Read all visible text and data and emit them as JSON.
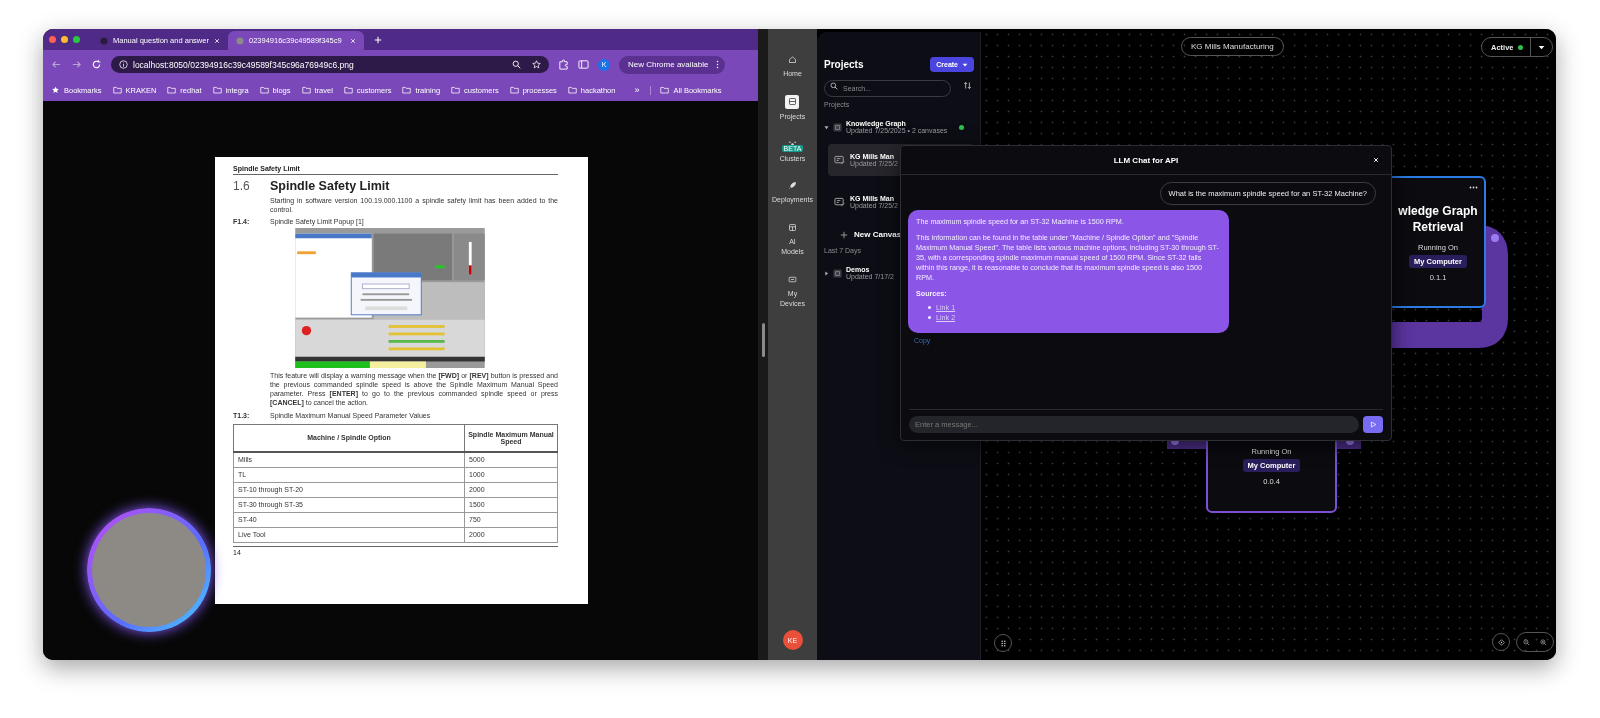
{
  "browser": {
    "tabs": [
      {
        "title": "Manual question and answer",
        "selected": false
      },
      {
        "title": "02394916c39c49589f345c9",
        "selected": true
      }
    ],
    "url": "localhost:8050/02394916c39c49589f345c96a76949c6.png",
    "profile_initial": "K",
    "update_button": "New Chrome available",
    "bookmarks": [
      {
        "label": "Bookmarks",
        "kind": "star"
      },
      {
        "label": "KRAKEN",
        "kind": "folder"
      },
      {
        "label": "redhat",
        "kind": "folder"
      },
      {
        "label": "integra",
        "kind": "folder"
      },
      {
        "label": "blogs",
        "kind": "folder"
      },
      {
        "label": "travel",
        "kind": "folder"
      },
      {
        "label": "customers",
        "kind": "folder"
      },
      {
        "label": "training",
        "kind": "folder"
      },
      {
        "label": "customers",
        "kind": "folder"
      },
      {
        "label": "processes",
        "kind": "folder"
      },
      {
        "label": "hackathon",
        "kind": "folder"
      }
    ],
    "more": "»",
    "all_bookmarks": "All Bookmarks"
  },
  "document": {
    "running_header": "Spindle Safety Limit",
    "section_number": "1.6",
    "section_title": "Spindle Safety Limit",
    "intro": "Starting in software version 100.19.000.1100 a spindle safety limit has been added to the control.",
    "figure_label": "F1.4:",
    "figure_caption": "Spindle Safety Limit Popup [1]",
    "paragraph": "This feature will display a warning message when the **[FWD]** or **[REV]** button is pressed and the previous commanded spindle speed is above the Spindle Maximum Manual Speed parameter. Press **[ENTER]** to go to the previous commanded spindle speed or press **[CANCEL]** to cancel the action.",
    "table_label": "T1.3:",
    "table_caption": "Spindle Maximum Manual Speed Parameter Values",
    "table": {
      "columns": [
        "Machine / Spindle Option",
        "Spindle Maximum Manual Speed"
      ],
      "rows": [
        [
          "Mills",
          "5000"
        ],
        [
          "TL",
          "1000"
        ],
        [
          "ST-10 through ST-20",
          "2000"
        ],
        [
          "ST-30 through ST-35",
          "1500"
        ],
        [
          "ST-40",
          "750"
        ],
        [
          "Live Tool",
          "2000"
        ]
      ]
    },
    "page_number": "14"
  },
  "app": {
    "sidebar": {
      "items": [
        {
          "label": "Home",
          "kind": "home",
          "selected": false
        },
        {
          "label": "Projects",
          "kind": "projects",
          "selected": true
        },
        {
          "label": "Clusters",
          "kind": "clusters",
          "selected": false,
          "badge": "BETA"
        },
        {
          "label": "Deployments",
          "kind": "deployments",
          "selected": false
        },
        {
          "label": "AI Models",
          "kind": "models",
          "selected": false
        },
        {
          "label": "My Devices",
          "kind": "devices",
          "selected": false
        }
      ],
      "user_initials": "KE"
    },
    "projects": {
      "title": "Projects",
      "create_button": "Create",
      "search_placeholder": "Search...",
      "section_label": "Projects",
      "items": [
        {
          "name": "Knowledge Graph",
          "meta": "Updated 7/25/2025 • 2 canvases",
          "expanded": true,
          "active": true,
          "children": [
            {
              "name": "KG Mills Man",
              "meta": "Updated 7/25/2",
              "selected": true
            },
            {
              "name": "KG Mills Man",
              "meta": "Updated 7/25/2",
              "selected": false
            }
          ]
        }
      ],
      "new_canvas": "New Canvas",
      "recent_label": "Last 7 Days",
      "recent_items": [
        {
          "name": "Demos",
          "meta": "Updated 7/17/2",
          "expanded": false
        }
      ]
    },
    "canvas": {
      "title": "KG Mills Manufacturing",
      "status": "Active",
      "nodes": [
        {
          "title": "wledge Graph Retrieval",
          "running_label": "Running On",
          "host": "My Computer",
          "version": "0.1.1",
          "selected": true
        },
        {
          "running_label": "Running On",
          "host": "My Computer",
          "version": "0.0.4",
          "selected": false
        }
      ]
    },
    "chat": {
      "title": "LLM Chat for API",
      "messages": [
        {
          "kind": "user",
          "text": "What is the maximum spindle speed for an ST-32 Machine?"
        },
        {
          "kind": "assistant",
          "paragraphs": [
            "The maximum spindle speed for an ST-32 Machine is 1500 RPM.",
            "This information can be found in the table under \"Machine / Spindle Option\" and \"Spindle Maximum Manual Speed\". The table lists various machine options, including ST-30 through ST-35, with a corresponding spindle maximum manual speed of 1500 RPM. Since ST-32 falls within this range, it is reasonable to conclude that its maximum spindle speed is also 1500 RPM."
          ],
          "sources_label": "Sources:",
          "links": [
            "Link 1",
            "Link 2"
          ],
          "copy": "Copy"
        }
      ],
      "input_placeholder": "Enter a message..."
    }
  }
}
